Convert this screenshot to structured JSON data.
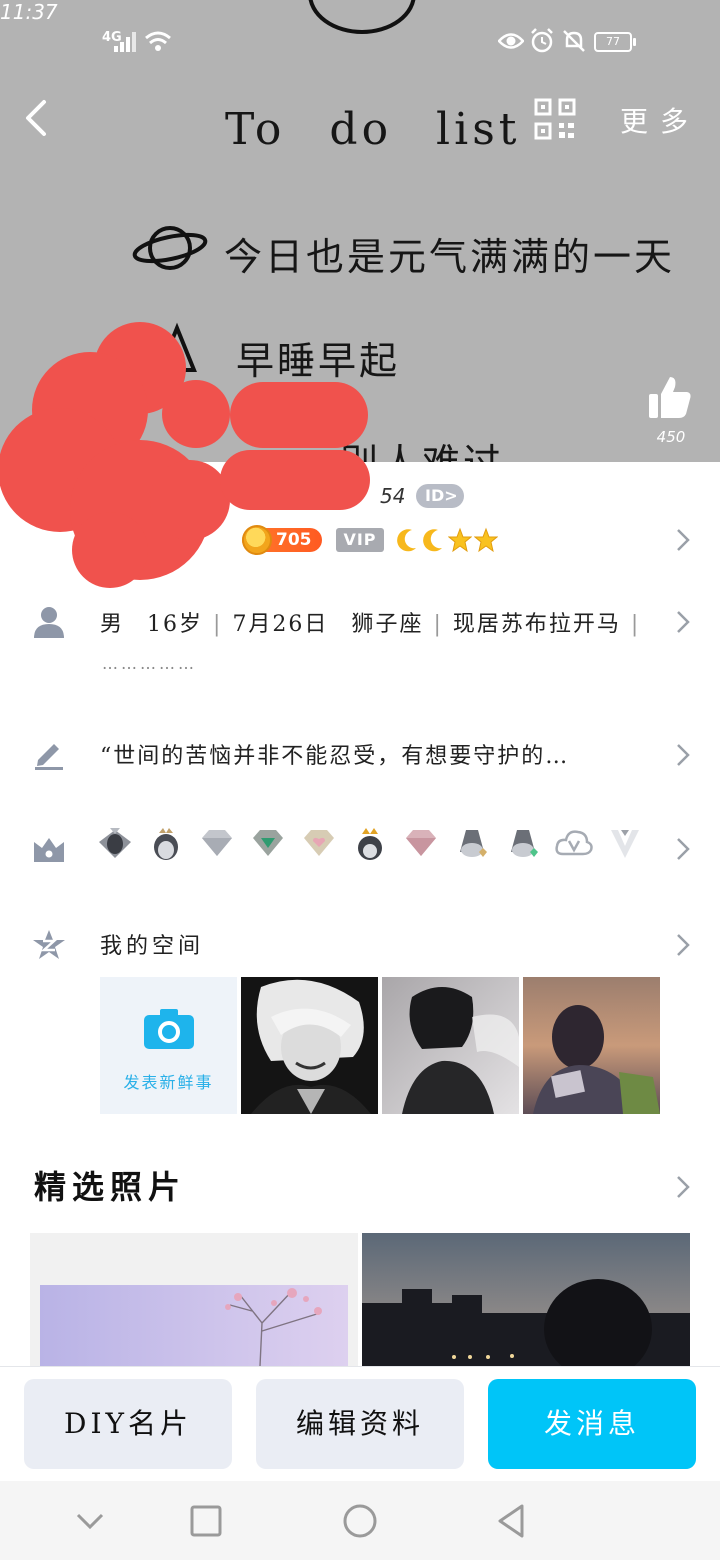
{
  "status_bar": {
    "signal_label": "4G",
    "battery": "77",
    "time": "11:37"
  },
  "cover": {
    "todo_title": "To do list",
    "line1": "今日也是元气满满的一天",
    "line2": "早睡早起",
    "line3": "别人难过"
  },
  "header": {
    "back_icon": "chevron-left-icon",
    "qr_icon": "qr-code-icon",
    "more_label": "更多"
  },
  "like": {
    "icon": "thumbs-up-icon",
    "count": "450"
  },
  "profile": {
    "uid_tail": "54",
    "id_badge": "ID>",
    "coins": "705",
    "vip_label": "VIP",
    "level_icons": [
      "moon-icon",
      "moon-icon",
      "star-icon",
      "star-icon"
    ]
  },
  "basic_info": {
    "gender": "男",
    "age": "16岁",
    "birthday": "7月26日",
    "zodiac": "狮子座",
    "location": "现居苏布拉开马",
    "more": "……………"
  },
  "signature": {
    "text": "“世间的苦恼并非不能忍受，有想要守护的…"
  },
  "badges": [
    "penguin-shield-icon",
    "penguin-crown-icon",
    "diamond-icon",
    "green-diamond-icon",
    "heart-diamond-icon",
    "penguin-gold-crown-icon",
    "pink-diamond-icon",
    "penguin-gem-icon",
    "penguin-green-gem-icon",
    "cloud-v-icon",
    "v-icon"
  ],
  "space": {
    "title": "我的空间",
    "post_label": "发表新鲜事",
    "photos": [
      "anime-portrait-photo",
      "dark-portrait-photo",
      "sunset-portrait-photo"
    ]
  },
  "featured": {
    "title": "精选照片",
    "photos": [
      "blossom-tree-photo",
      "night-silhouette-photo"
    ]
  },
  "actions": {
    "diy_label": "DIY名片",
    "edit_label": "编辑资料",
    "message_label": "发消息"
  },
  "colors": {
    "accent": "#00c5f8",
    "cover_bg": "#b3b3b3",
    "coin": "#ff6a24",
    "redaction": "#f0524d"
  }
}
